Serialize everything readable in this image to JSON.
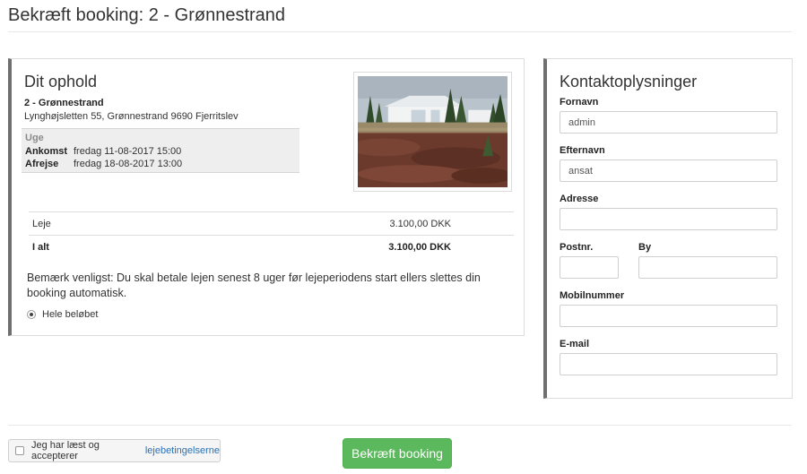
{
  "page": {
    "title": "Bekræft booking: 2 - Grønnestrand"
  },
  "stay": {
    "heading": "Dit ophold",
    "property_name": "2 - Grønnestrand",
    "address": "Lynghøjsletten 55, Grønnestrand 9690 Fjerritslev",
    "period_label": "Uge",
    "arrival_label": "Ankomst",
    "arrival_value": "fredag 11-08-2017 15:00",
    "departure_label": "Afrejse",
    "departure_value": "fredag 18-08-2017 13:00",
    "prices": [
      {
        "label": "Leje",
        "amount": "3.100,00 DKK"
      },
      {
        "label": "I alt",
        "amount": "3.100,00 DKK"
      }
    ],
    "notice": "Bemærk venligst: Du skal betale lejen senest 8 uger før lejeperiodens start ellers slettes din booking automatisk.",
    "payment_option": "Hele beløbet"
  },
  "contact": {
    "heading": "Kontaktoplysninger",
    "first_name_label": "Fornavn",
    "first_name_value": "admin",
    "last_name_label": "Efternavn",
    "last_name_value": "ansat",
    "address_label": "Adresse",
    "address_value": "",
    "postal_label": "Postnr.",
    "postal_value": "",
    "city_label": "By",
    "city_value": "",
    "mobile_label": "Mobilnummer",
    "mobile_value": "",
    "email_label": "E-mail",
    "email_value": ""
  },
  "footer": {
    "terms_text": "Jeg har læst og accepterer ",
    "terms_link": "lejebetingelserne",
    "confirm_label": "Bekræft booking"
  },
  "colors": {
    "accent_green": "#5cb85c",
    "link_blue": "#2a72b5",
    "panel_border": "#6f6f6f"
  }
}
